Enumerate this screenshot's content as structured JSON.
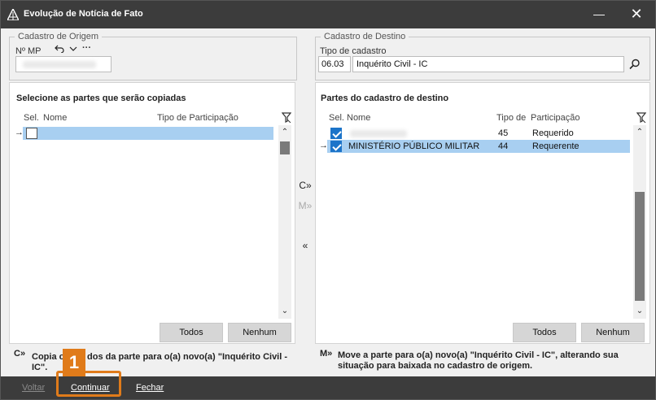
{
  "window": {
    "title": "Evolução de Notícia de Fato",
    "minimize": "—",
    "close": "✕"
  },
  "origem": {
    "legend": "Cadastro de Origem",
    "mp_label": "Nº MP",
    "icons": [
      "undo-icon",
      "chevron-down-icon",
      "more-icon"
    ],
    "more": "···"
  },
  "destino": {
    "legend": "Cadastro de Destino",
    "tipo_label": "Tipo de cadastro",
    "code": "06.03",
    "tipo_value": "Inquérito Civil - IC"
  },
  "left_panel": {
    "title": "Selecione as partes que serão copiadas",
    "columns": {
      "sel": "Sel.",
      "nome": "Nome",
      "tipo": "Tipo de Participação"
    },
    "rows": [
      {
        "checked": false,
        "nome": "",
        "tipo": ""
      }
    ],
    "buttons": {
      "todos": "Todos",
      "nenhum": "Nenhum"
    }
  },
  "right_panel": {
    "title": "Partes do cadastro de destino",
    "columns": {
      "sel": "Sel.",
      "nome": "Nome",
      "codigo": "Tipo de",
      "tipo": "Participação"
    },
    "rows": [
      {
        "checked": true,
        "nome": "",
        "codigo": "45",
        "tipo": "Requerido"
      },
      {
        "checked": true,
        "nome": "MINISTÉRIO PÚBLICO MILITAR",
        "codigo": "44",
        "tipo": "Requerente"
      }
    ],
    "buttons": {
      "todos": "Todos",
      "nenhum": "Nenhum"
    }
  },
  "middle": {
    "copy": "C»",
    "move": "M»",
    "back": "«"
  },
  "notes": {
    "copy_icon": "C»",
    "copy_text_1": "Copia o",
    "copy_text_2": "dos da parte para o(a) novo(a) \"Inquérito Civil -",
    "copy_text_3": "IC\".",
    "move_icon": "M»",
    "move_text_1": "Move a parte para o(a) novo(a) \"Inquérito Civil - IC\", alterando sua",
    "move_text_2": "situação para baixada no cadastro de origem."
  },
  "footer": {
    "voltar": "Voltar",
    "continuar": "Continuar",
    "fechar": "Fechar"
  },
  "step_badge": "1",
  "colors": {
    "titlebar": "#3c3c3c",
    "selection": "#a8cff1",
    "checkbox": "#1c74c9",
    "highlight": "#e07b1a"
  }
}
